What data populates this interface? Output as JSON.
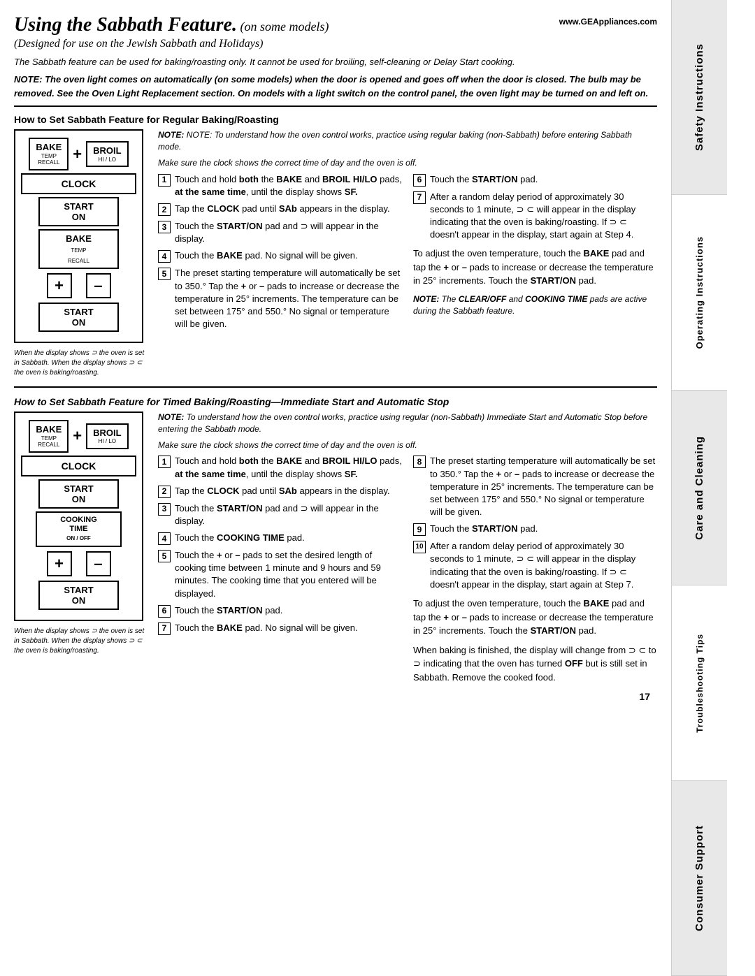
{
  "header": {
    "title": "Using the Sabbath Feature.",
    "title_suffix": " (on some models)",
    "subtitle": "(Designed for use on the Jewish Sabbath and Holidays)",
    "website": "www.GEAppliances.com",
    "note1": "The Sabbath feature can be used for baking/roasting only. It cannot be used for broiling, self-cleaning or Delay Start cooking.",
    "note2": "NOTE: The oven light comes on automatically (on some models) when the door is opened and goes off when the door is closed. The bulb may be removed. See the Oven Light Replacement section. On models with a light switch on the control panel, the oven light may be turned on and left on."
  },
  "section1": {
    "title": "How to Set Sabbath Feature for Regular Baking/Roasting",
    "note_pre": "NOTE: To understand how the oven control works, practice using regular baking (non-Sabbath) before entering Sabbath mode.",
    "note_pre2": "Make sure the clock shows the correct time of day and the oven is off.",
    "steps": [
      {
        "num": "1",
        "text": "Touch and hold both the BAKE and BROIL HI/LO pads, at the same time, until the display shows SF."
      },
      {
        "num": "2",
        "text": "Tap the CLOCK pad until SAb appears in the display."
      },
      {
        "num": "3",
        "text": "Touch the START/ON pad and ⊃ will appear in the display."
      },
      {
        "num": "4",
        "text": "Touch the BAKE pad. No signal will be given."
      },
      {
        "num": "5",
        "text": "The preset starting temperature will automatically be set to 350.° Tap the + or – pads to increase or decrease the temperature in 25° increments. The temperature can be set between 175° and 550.° No signal or temperature will be given."
      }
    ],
    "steps_right": [
      {
        "num": "6",
        "text": "Touch the START/ON pad."
      },
      {
        "num": "7",
        "text": "After a random delay period of approximately 30 seconds to 1 minute, ⊃ ⊂ will appear in the display indicating that the oven is baking/roasting. If ⊃ ⊂ doesn't appear in the display, start again at Step 4."
      }
    ],
    "adjust_text": "To adjust the oven temperature, touch the BAKE pad and tap the + or – pads to increase or decrease the temperature in 25° increments. Touch the START/ON pad.",
    "note_clear": "NOTE: The CLEAR/OFF and COOKING TIME pads are active during the Sabbath feature.",
    "caption": "When the display shows ⊃ the oven is set in Sabbath. When the display shows ⊃ ⊂ the oven is baking/roasting."
  },
  "section2": {
    "title": "How to Set Sabbath Feature for Timed Baking/Roasting—Immediate Start and Automatic Stop",
    "note_pre": "NOTE: To understand how the oven control works, practice using regular (non-Sabbath) Immediate Start and Automatic Stop before entering the Sabbath mode.",
    "note_pre2": "Make sure the clock shows the correct time of day and the oven is off.",
    "steps": [
      {
        "num": "1",
        "text": "Touch and hold both the BAKE and BROIL HI/LO pads, at the same time, until the display shows SF."
      },
      {
        "num": "2",
        "text": "Tap the CLOCK pad until SAb appears in the display."
      },
      {
        "num": "3",
        "text": "Touch the START/ON pad and ⊃ will appear in the display."
      },
      {
        "num": "4",
        "text": "Touch the COOKING TIME pad."
      },
      {
        "num": "5",
        "text": "Touch the + or – pads to set the desired length of cooking time between 1 minute and 9 hours and 59 minutes. The cooking time that you entered will be displayed."
      },
      {
        "num": "6",
        "text": "Touch the START/ON pad."
      },
      {
        "num": "7",
        "text": "Touch the BAKE pad. No signal will be given."
      }
    ],
    "steps_right": [
      {
        "num": "8",
        "text": "The preset starting temperature will automatically be set to 350.° Tap the + or – pads to increase or decrease the temperature in 25° increments. The temperature can be set between 175° and 550.° No signal or temperature will be given."
      },
      {
        "num": "9",
        "text": "Touch the START/ON pad."
      },
      {
        "num": "10",
        "text": "After a random delay period of approximately 30 seconds to 1 minute, ⊃ ⊂ will appear in the display indicating that the oven is baking/roasting. If ⊃ ⊂ doesn't appear in the display, start again at Step 7."
      }
    ],
    "adjust_text": "To adjust the oven temperature, touch the BAKE pad and tap the + or – pads to increase or decrease the temperature in 25° increments. Touch the START/ON pad.",
    "finish_text": "When baking is finished, the display will change from ⊃ ⊂ to ⊃ indicating that the oven has turned OFF but is still set in Sabbath. Remove the cooked food.",
    "caption": "When the display shows ⊃ the oven is set in Sabbath. When the display shows ⊃ ⊂ the oven is baking/roasting."
  },
  "controls": {
    "bake_label": "BAKE",
    "bake_sub": "TEMP\nRECALL",
    "broil_label": "BROIL",
    "broil_sub": "HI / LO",
    "clock_label": "CLOCK",
    "start_label": "START\nON",
    "plus_label": "+",
    "minus_label": "–",
    "cooking_time_label": "COOKING\nTIME",
    "cooking_time_sub": "ON / OFF"
  },
  "sidebar": {
    "sections": [
      {
        "label": "Safety Instructions",
        "id": "safety"
      },
      {
        "label": "Operating Instructions",
        "id": "operating"
      },
      {
        "label": "Care and Cleaning",
        "id": "care"
      },
      {
        "label": "Troubleshooting Tips",
        "id": "troubleshooting"
      },
      {
        "label": "Consumer Support",
        "id": "consumer"
      }
    ]
  },
  "page_number": "17"
}
